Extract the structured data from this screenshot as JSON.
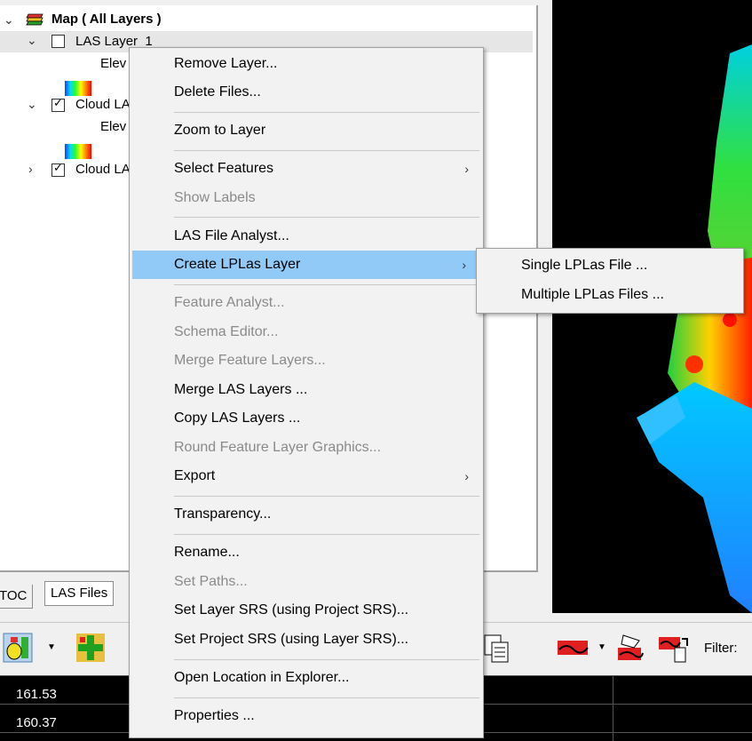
{
  "toc": {
    "root_label": "Map ( All Layers )",
    "layers": [
      {
        "label": "LAS Layer_1",
        "checked": false,
        "expanded": true,
        "child": "Elev"
      },
      {
        "label": "Cloud LA",
        "checked": true,
        "expanded": true,
        "child": "Elev"
      },
      {
        "label": "Cloud LA",
        "checked": true,
        "expanded": false
      }
    ],
    "tabs": [
      "TOC",
      "LAS Files"
    ]
  },
  "context_menu": {
    "items": [
      {
        "label": "Remove Layer...",
        "enabled": true
      },
      {
        "label": "Delete Files...",
        "enabled": true
      },
      {
        "label": "Zoom to Layer",
        "enabled": true
      },
      {
        "label": "Select Features",
        "enabled": true,
        "submenu": true
      },
      {
        "label": "Show Labels",
        "enabled": false
      },
      {
        "label": "LAS File Analyst...",
        "enabled": true
      },
      {
        "label": "Create LPLas Layer",
        "enabled": true,
        "submenu": true,
        "highlighted": true
      },
      {
        "label": "Feature Analyst...",
        "enabled": false
      },
      {
        "label": "Schema Editor...",
        "enabled": false
      },
      {
        "label": "Merge Feature Layers...",
        "enabled": false
      },
      {
        "label": "Merge LAS Layers ...",
        "enabled": true
      },
      {
        "label": "Copy LAS Layers ...",
        "enabled": true
      },
      {
        "label": "Round Feature Layer Graphics...",
        "enabled": false
      },
      {
        "label": "Export",
        "enabled": true,
        "submenu": true
      },
      {
        "label": "Transparency...",
        "enabled": true
      },
      {
        "label": "Rename...",
        "enabled": true
      },
      {
        "label": "Set Paths...",
        "enabled": false
      },
      {
        "label": "Set Layer SRS (using Project SRS)...",
        "enabled": true
      },
      {
        "label": "Set Project SRS (using Layer SRS)...",
        "enabled": true
      },
      {
        "label": "Open Location in Explorer...",
        "enabled": true
      },
      {
        "label": "Properties ...",
        "enabled": true
      }
    ],
    "submenu_items": [
      "Single LPLas File ...",
      "Multiple LPLas Files ..."
    ]
  },
  "toolbar": {
    "filter_label": "Filter:"
  },
  "grid": {
    "values": [
      "161.53",
      "160.37"
    ]
  },
  "colors": {
    "highlight": "#91c9f7",
    "disabled_text": "#8a8a8a",
    "map_background": "#000000"
  }
}
